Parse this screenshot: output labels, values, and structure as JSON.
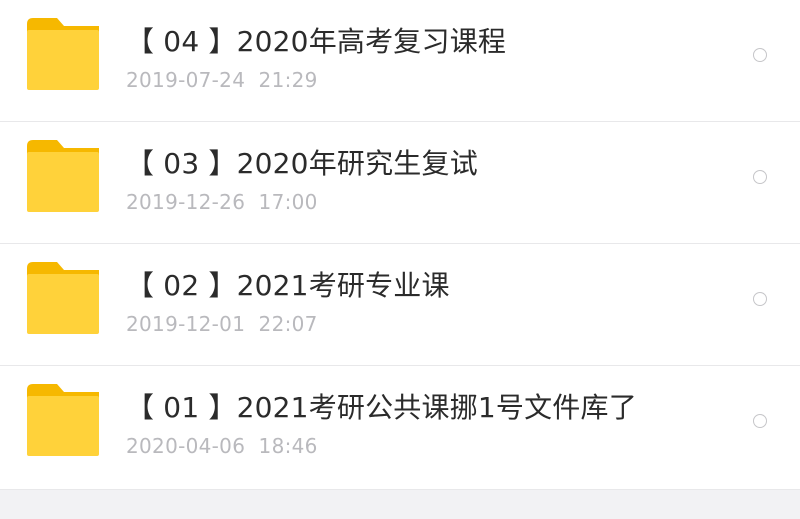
{
  "folders": [
    {
      "name": "【 04 】2020年高考复习课程",
      "date": "2019-07-24  21:29",
      "icon": "folder-icon"
    },
    {
      "name": "【 03 】2020年研究生复试",
      "date": "2019-12-26  17:00",
      "icon": "folder-icon"
    },
    {
      "name": "【 02 】2021考研专业课",
      "date": "2019-12-01  22:07",
      "icon": "folder-icon"
    },
    {
      "name": "【 01 】2021考研公共课挪1号文件库了",
      "date": "2020-04-06  18:46",
      "icon": "folder-icon"
    }
  ],
  "colors": {
    "folder_front": "#FFD23A",
    "folder_tab": "#F6B800",
    "title_text": "#2b2b2b",
    "date_text": "#b9b9bd",
    "divider": "#e8e8ea",
    "background": "#f2f2f4"
  }
}
